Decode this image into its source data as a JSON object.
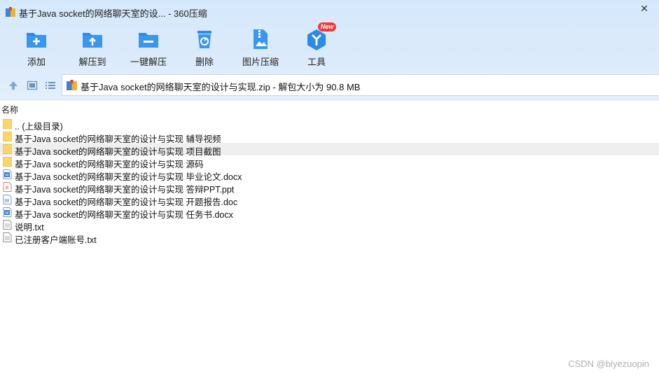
{
  "window": {
    "title": "基于Java socket的网络聊天室的设... - 360压缩",
    "close_glyph": "✕"
  },
  "toolbar": {
    "items": [
      {
        "label": "添加",
        "icon": "add-folder-icon"
      },
      {
        "label": "解压到",
        "icon": "extract-to-icon"
      },
      {
        "label": "一键解压",
        "icon": "one-click-extract-icon"
      },
      {
        "label": "删除",
        "icon": "recycle-bin-icon"
      },
      {
        "label": "图片压缩",
        "icon": "image-compress-icon"
      },
      {
        "label": "工具",
        "icon": "tools-icon"
      }
    ],
    "badge": "New"
  },
  "path": {
    "text": "基于Java socket的网络聊天室的设计与实现.zip - 解包大小为 90.8 MB"
  },
  "list": {
    "header_name": "名称",
    "rows": [
      {
        "name": ".. (上级目录)",
        "type": "folder"
      },
      {
        "name": "基于Java socket的网络聊天室的设计与实现 辅导视频",
        "type": "folder"
      },
      {
        "name": "基于Java socket的网络聊天室的设计与实现 项目截图",
        "type": "folder",
        "selected": true
      },
      {
        "name": "基于Java socket的网络聊天室的设计与实现 源码",
        "type": "folder"
      },
      {
        "name": "基于Java socket的网络聊天室的设计与实现 毕业论文.docx",
        "type": "word"
      },
      {
        "name": "基于Java socket的网络聊天室的设计与实现 答辩PPT.ppt",
        "type": "ppt"
      },
      {
        "name": "基于Java socket的网络聊天室的设计与实现 开题报告.doc",
        "type": "word-doc"
      },
      {
        "name": "基于Java socket的网络聊天室的设计与实现 任务书.docx",
        "type": "word"
      },
      {
        "name": "说明.txt",
        "type": "txt"
      },
      {
        "name": "已注册客户端账号.txt",
        "type": "txt"
      }
    ]
  },
  "watermark": "CSDN @biyezuopin",
  "colors": {
    "accent": "#2b8be6",
    "folder": "#ffd665",
    "badge": "#ee3a3a"
  }
}
